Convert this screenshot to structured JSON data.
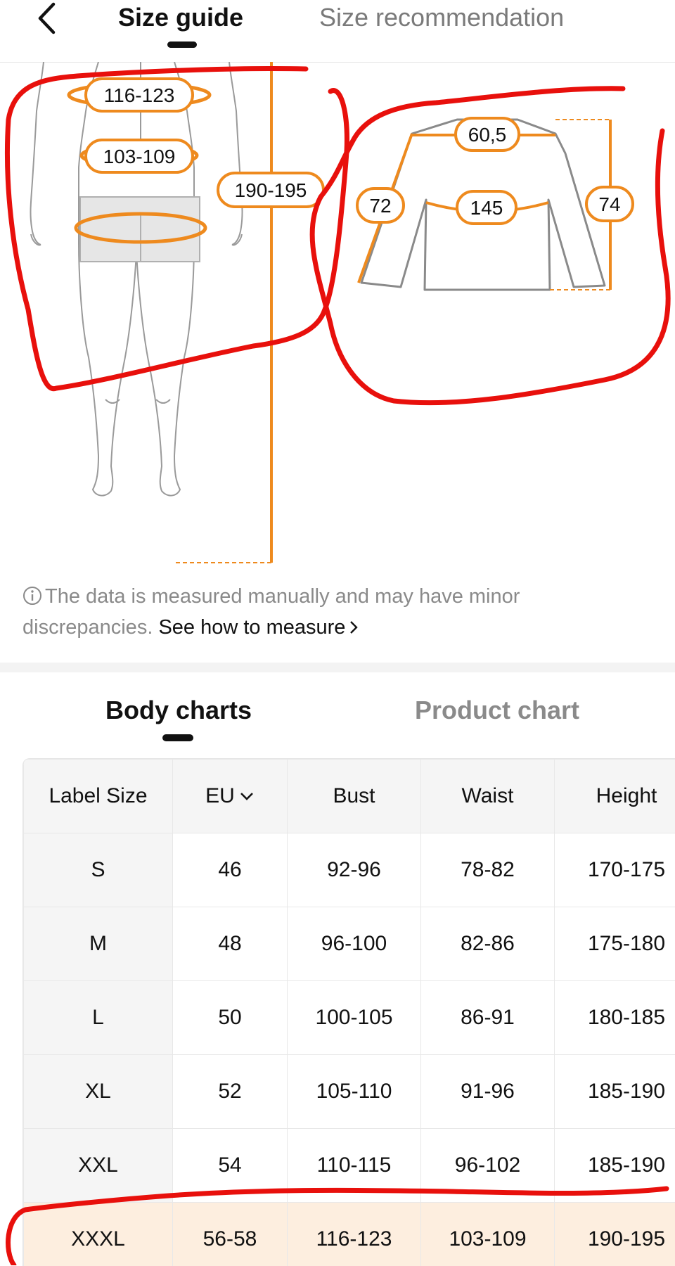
{
  "header": {
    "tabs": [
      {
        "label": "Size guide",
        "active": true
      },
      {
        "label": "Size recommendation",
        "active": false
      }
    ]
  },
  "body_figure": {
    "labels": [
      "116-123",
      "103-109",
      "190-195"
    ]
  },
  "garment_figure": {
    "labels": [
      "60,5",
      "72",
      "145",
      "74"
    ]
  },
  "note": {
    "text": "The data is measured manually and may have minor discrepancies.",
    "link_label": "See how to measure"
  },
  "chart_tabs": [
    {
      "label": "Body charts",
      "active": true
    },
    {
      "label": "Product chart",
      "active": false
    }
  ],
  "table": {
    "headers": [
      "Label Size",
      "EU",
      "Bust",
      "Waist",
      "Height"
    ],
    "rows": [
      [
        "S",
        "46",
        "92-96",
        "78-82",
        "170-175"
      ],
      [
        "M",
        "48",
        "96-100",
        "82-86",
        "175-180"
      ],
      [
        "L",
        "50",
        "100-105",
        "86-91",
        "180-185"
      ],
      [
        "XL",
        "52",
        "105-110",
        "91-96",
        "185-190"
      ],
      [
        "XXL",
        "54",
        "110-115",
        "96-102",
        "185-190"
      ],
      [
        "XXXL",
        "56-58",
        "116-123",
        "103-109",
        "190-195"
      ]
    ],
    "highlighted_row": 5
  },
  "colors": {
    "accent_orange": "#ee8a1e",
    "annotation_red": "#e8100c",
    "highlight_row": "#fdeedf"
  },
  "icons": [
    "chevron-left-icon",
    "info-icon",
    "chevron-right-icon",
    "chevron-down-icon"
  ]
}
